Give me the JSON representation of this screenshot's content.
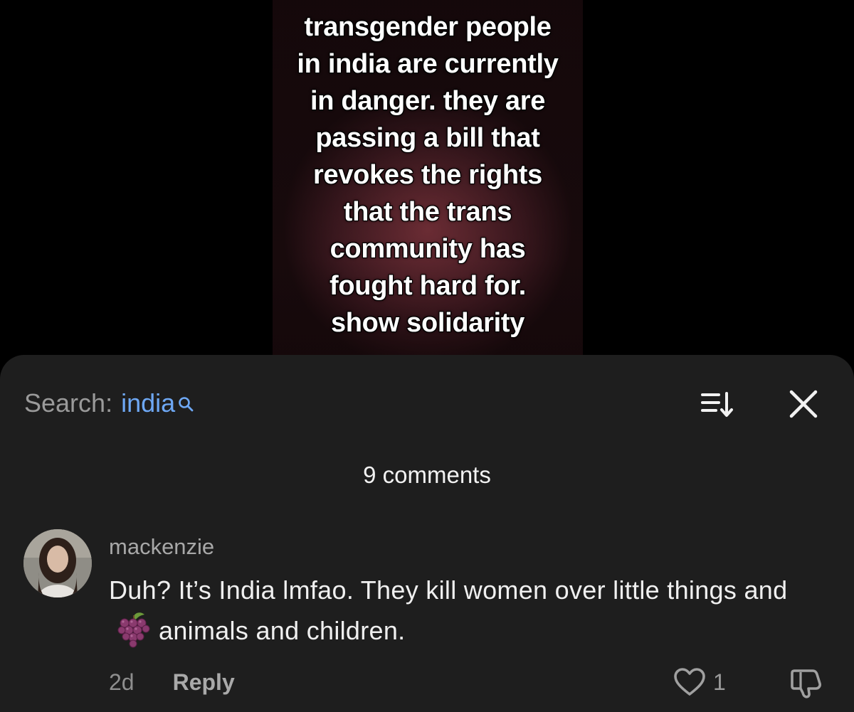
{
  "video": {
    "caption": "transgender people\nin india are currently\nin danger. they are\npassing a bill that\nrevokes the rights\nthat the trans\ncommunity has\nfought hard for.\nshow solidarity"
  },
  "comments_panel": {
    "search_label": "Search:",
    "search_query": "india",
    "search_icon": "magnifier-icon",
    "sort_icon": "sort-icon",
    "close_icon": "close-icon",
    "count_label": "9 comments",
    "accent_color": "#6ea8f5",
    "background_color": "#1e1e1e"
  },
  "comment": {
    "author": "mackenzie",
    "text_part1": "Duh? It’s India lmfao. They kill women over little things and",
    "emoji": "grapes-icon",
    "text_part2": "animals and children.",
    "time": "2d",
    "reply_label": "Reply",
    "like_count": "1",
    "like_icon": "heart-icon",
    "dislike_icon": "thumbs-down-icon"
  }
}
